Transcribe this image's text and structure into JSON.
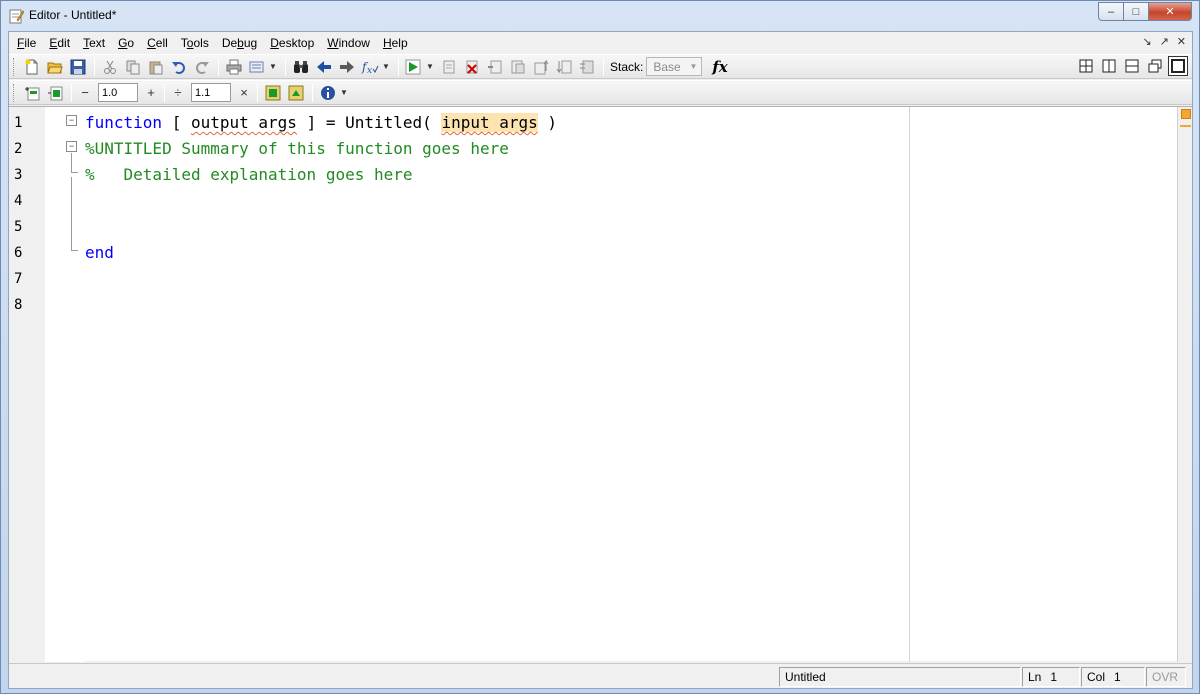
{
  "window": {
    "title": "Editor - Untitled*",
    "buttons": {
      "minimize": "–",
      "maximize": "□",
      "close": "✕"
    }
  },
  "menubar": {
    "items": [
      {
        "label": "File",
        "mnemonic": "F"
      },
      {
        "label": "Edit",
        "mnemonic": "E"
      },
      {
        "label": "Text",
        "mnemonic": "T"
      },
      {
        "label": "Go",
        "mnemonic": "G"
      },
      {
        "label": "Cell",
        "mnemonic": "C"
      },
      {
        "label": "Tools",
        "mnemonic": "o"
      },
      {
        "label": "Debug",
        "mnemonic": "b"
      },
      {
        "label": "Desktop",
        "mnemonic": "D"
      },
      {
        "label": "Window",
        "mnemonic": "W"
      },
      {
        "label": "Help",
        "mnemonic": "H"
      }
    ],
    "right_icons": [
      "↘",
      "↗",
      "✕"
    ]
  },
  "toolbar": {
    "stack_label": "Stack:",
    "stack_value": "Base",
    "fx_label": "fx",
    "icons": [
      "new-file-icon",
      "open-folder-icon",
      "save-icon",
      "cut-icon",
      "copy-icon",
      "paste-icon",
      "undo-icon",
      "redo-icon",
      "print-icon",
      "publish-icon",
      "find-icon",
      "back-icon",
      "forward-icon",
      "function-browser-icon",
      "run-icon",
      "breakpoint-set-icon",
      "breakpoint-clear-icon",
      "step-icon",
      "step-in-icon",
      "step-out-icon",
      "continue-icon",
      "exit-debug-icon"
    ]
  },
  "cell_toolbar": {
    "minus": "−",
    "increment_value": "1.0",
    "plus": "+",
    "divide": "÷",
    "factor_value": "1.1",
    "times": "×"
  },
  "editor": {
    "line_numbers": [
      "1",
      "2",
      "3",
      "4",
      "5",
      "6",
      "7",
      "8"
    ],
    "lines": {
      "l1_kw": "function",
      "l1_a": " [ ",
      "l1_out": "output args",
      "l1_b": " ] = Untitled( ",
      "l1_in": "input args",
      "l1_c": " )",
      "l2": "%UNTITLED Summary of this function goes here",
      "l3": "%   Detailed explanation goes here",
      "l6_kw": "end"
    }
  },
  "statusbar": {
    "file": "Untitled",
    "ln_label": "Ln",
    "ln_value": "1",
    "col_label": "Col",
    "col_value": "1",
    "ovr": "OVR"
  },
  "colors": {
    "keyword": "#0000ff",
    "comment": "#228b22",
    "highlight": "#fde3b2",
    "warning": "#f7a531"
  }
}
